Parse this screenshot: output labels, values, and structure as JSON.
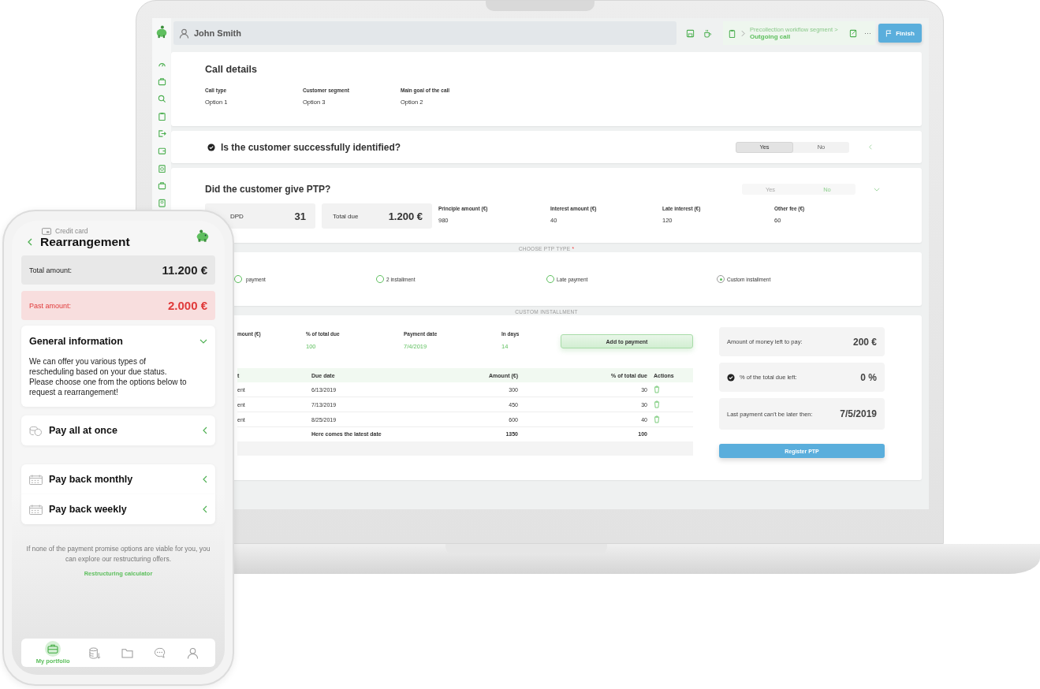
{
  "laptop": {
    "header": {
      "user": "John Smith",
      "breadcrumb": "Precollection workflow segment >",
      "step": "Outgoing call",
      "more": "···",
      "finish": "Finish"
    },
    "call_details": {
      "title": "Call details",
      "fields": [
        {
          "label": "Call type",
          "value": "Option 1"
        },
        {
          "label": "Customer segment",
          "value": "Option 3"
        },
        {
          "label": "Main goal of the call",
          "value": "Option 2"
        }
      ]
    },
    "identified": {
      "question": "Is the customer successfully identified?",
      "options": [
        {
          "label": "Yes",
          "selected": true
        },
        {
          "label": "No",
          "selected": false
        }
      ]
    },
    "ptp": {
      "question": "Did the customer give PTP?",
      "options": [
        {
          "label": "Yes",
          "selected": false
        },
        {
          "label": "No",
          "selected": true
        }
      ],
      "stats": [
        {
          "label": "DPD",
          "value": "31"
        },
        {
          "label": "Total due",
          "value": "1.200 €"
        }
      ],
      "amounts": [
        {
          "label": "Principle amount (€)",
          "value": "980"
        },
        {
          "label": "Interest amount (€)",
          "value": "40"
        },
        {
          "label": "Late interest (€)",
          "value": "120"
        },
        {
          "label": "Other fee (€)",
          "value": "60"
        }
      ]
    },
    "ptp_type": {
      "heading": "CHOOSE PTP TYPE",
      "required_mark": "*",
      "options": [
        {
          "label": "payment",
          "selected": false
        },
        {
          "label": "2 installment",
          "selected": false
        },
        {
          "label": "Late payment",
          "selected": false
        },
        {
          "label": "Custom installment",
          "selected": true
        }
      ]
    },
    "custom_installment": {
      "heading": "CUSTOM INSTALLMENT",
      "fields": [
        {
          "label": "mount (€)"
        },
        {
          "label": "% of total due",
          "value": "100"
        },
        {
          "label": "Payment date",
          "value": "7/4/2019"
        },
        {
          "label": "In days",
          "value": "14"
        }
      ],
      "add_button": "Add to payment",
      "table": {
        "columns": [
          "t",
          "Due date",
          "Amount (€)",
          "% of total due",
          "Actions"
        ],
        "rows": [
          [
            "ent",
            "6/13/2019",
            "300",
            "30"
          ],
          [
            "ent",
            "7/13/2019",
            "450",
            "30"
          ],
          [
            "ent",
            "8/25/2019",
            "600",
            "40"
          ]
        ],
        "total": [
          "Here comes the latest date",
          "1350",
          "100"
        ]
      },
      "summary": [
        {
          "label": "Amount of money left to pay:",
          "value": "200 €",
          "checked": false
        },
        {
          "label": "% of the total due left:",
          "value": "0 %",
          "checked": true
        },
        {
          "label": "Last payment can't be later then:",
          "value": "7/5/2019",
          "checked": false
        }
      ],
      "register_button": "Register PTP"
    }
  },
  "phone": {
    "subtitle": "Credit card",
    "title": "Rearrangement",
    "amounts": [
      {
        "label": "Total amount:",
        "value": "11.200 €",
        "kind": "normal"
      },
      {
        "label": "Past amount:",
        "value": "2.000 €",
        "kind": "warning"
      }
    ],
    "info": {
      "title": "General information",
      "expanded": true,
      "text": "We can offer you various types of rescheduling based on your due status. Please choose one from the options below to request a rearrangement!"
    },
    "options": [
      {
        "label": "Pay all at once",
        "kind": "coins"
      },
      {
        "label": "Pay back monthly",
        "kind": "calendar"
      },
      {
        "label": "Pay back weekly",
        "kind": "calendar"
      }
    ],
    "note": "If none of the payment promise options are viable for you, you can explore our restructuring offers.",
    "link": "Restructuring calculator",
    "nav": [
      {
        "label": "My portfolio",
        "kind": "briefcase",
        "selected": true
      },
      {
        "kind": "coins",
        "selected": false
      },
      {
        "kind": "folder",
        "selected": false
      },
      {
        "kind": "chat",
        "selected": false
      },
      {
        "kind": "user",
        "selected": false
      }
    ]
  }
}
